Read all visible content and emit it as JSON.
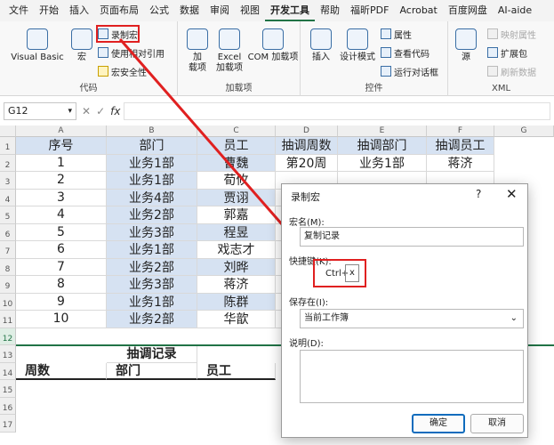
{
  "menu": [
    "文件",
    "开始",
    "插入",
    "页面布局",
    "公式",
    "数据",
    "审阅",
    "视图",
    "开发工具",
    "帮助",
    "福昕PDF",
    "Acrobat",
    "百度网盘",
    "AI-aide"
  ],
  "ribbon": {
    "code_group": {
      "visual_basic": "Visual Basic",
      "macro": "宏",
      "record_macro": "录制宏",
      "relative_ref": "使用相对引用",
      "macro_security": "宏安全性",
      "label": "代码"
    },
    "addins_group": {
      "addins": "加\n载项",
      "excel_addins": "Excel\n加载项",
      "com_addins": "COM 加载项",
      "label": "加载项"
    },
    "controls_group": {
      "insert": "插入",
      "design_mode": "设计模式",
      "properties": "属性",
      "view_code": "查看代码",
      "run_dialog": "运行对话框",
      "label": "控件"
    },
    "xml_group": {
      "source": "源",
      "map_props": "映射属性",
      "expansion": "扩展包",
      "refresh": "刷新数据",
      "label": "XML"
    }
  },
  "formula_bar": {
    "namebox": "G12",
    "fx": "fx"
  },
  "columns": [
    "A",
    "B",
    "C",
    "D",
    "E",
    "F",
    "G"
  ],
  "rows": [
    "1",
    "2",
    "3",
    "4",
    "5",
    "6",
    "7",
    "8",
    "9",
    "10",
    "11",
    "12",
    "13",
    "14",
    "15",
    "16",
    "17"
  ],
  "table": {
    "headers": [
      "序号",
      "部门",
      "员工",
      "抽调周数",
      "抽调部门",
      "抽调员工"
    ],
    "data": [
      [
        "1",
        "业务1部",
        "曹魏",
        "第20周",
        "业务1部",
        "蒋济"
      ],
      [
        "2",
        "业务1部",
        "荀攸",
        "",
        "",
        ""
      ],
      [
        "3",
        "业务4部",
        "贾诩",
        "",
        "",
        ""
      ],
      [
        "4",
        "业务2部",
        "郭嘉",
        "",
        "",
        ""
      ],
      [
        "5",
        "业务3部",
        "程昱",
        "",
        "",
        ""
      ],
      [
        "6",
        "业务1部",
        "戏志才",
        "",
        "",
        ""
      ],
      [
        "7",
        "业务2部",
        "刘晔",
        "",
        "",
        ""
      ],
      [
        "8",
        "业务3部",
        "蒋济",
        "",
        "",
        ""
      ],
      [
        "9",
        "业务1部",
        "陈群",
        "",
        "",
        ""
      ],
      [
        "10",
        "业务2部",
        "华歆",
        "",
        "",
        ""
      ]
    ]
  },
  "record_section": {
    "title": "抽调记录",
    "headers": [
      "周数",
      "部门",
      "员工"
    ]
  },
  "dialog": {
    "title": "录制宏",
    "help": "?",
    "close": "✕",
    "macro_name_label": "宏名(M):",
    "macro_name_value": "复制记录",
    "shortcut_label": "快捷键(K):",
    "ctrl_label": "Ctrl+",
    "shortcut_key": "x",
    "store_label": "保存在(I):",
    "store_value": "当前工作簿",
    "desc_label": "说明(D):",
    "ok": "确定",
    "cancel": "取消"
  },
  "colors": {
    "accent": "#217346",
    "highlight_red": "#e02020",
    "table_band": "#d6e2f2",
    "ok_border": "#0f6cbd"
  }
}
